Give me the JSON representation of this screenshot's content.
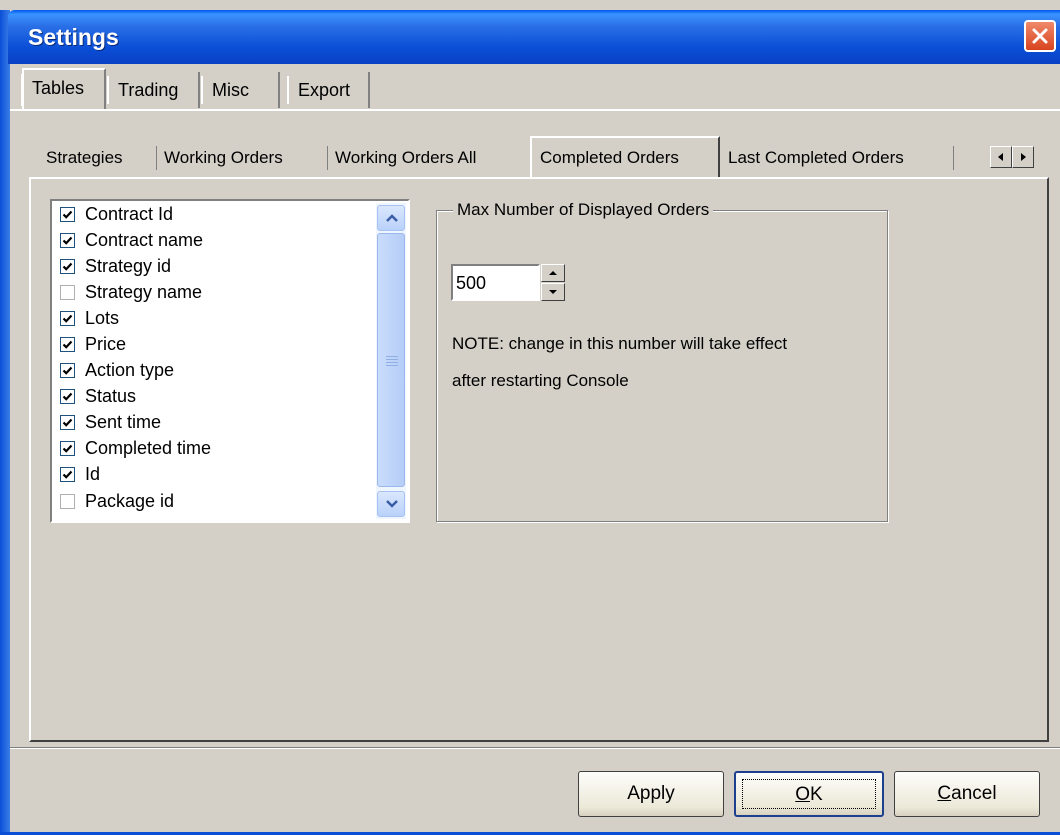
{
  "window": {
    "title": "Settings"
  },
  "main_tabs": [
    {
      "label": "Tables",
      "active": true
    },
    {
      "label": "Trading",
      "active": false
    },
    {
      "label": "Misc",
      "active": false
    },
    {
      "label": "Export",
      "active": false
    }
  ],
  "sub_tabs": [
    {
      "label": "Strategies",
      "active": false
    },
    {
      "label": "Working Orders",
      "active": false
    },
    {
      "label": "Working Orders All",
      "active": false
    },
    {
      "label": "Completed Orders",
      "active": true
    },
    {
      "label": "Last Completed Orders",
      "active": false
    }
  ],
  "columns_list": {
    "items": [
      {
        "label": "Contract Id",
        "checked": true
      },
      {
        "label": "Contract name",
        "checked": true
      },
      {
        "label": "Strategy id",
        "checked": true
      },
      {
        "label": "Strategy name",
        "checked": false
      },
      {
        "label": "Lots",
        "checked": true
      },
      {
        "label": "Price",
        "checked": true
      },
      {
        "label": "Action type",
        "checked": true
      },
      {
        "label": "Status",
        "checked": true
      },
      {
        "label": "Sent time",
        "checked": true
      },
      {
        "label": "Completed time",
        "checked": true
      },
      {
        "label": "Id",
        "checked": true
      },
      {
        "label": "Package id",
        "checked": false
      }
    ]
  },
  "max_orders": {
    "group_label": "Max Number of Displayed Orders",
    "value": "500",
    "note_line1": "NOTE: change in this number will take effect",
    "note_line2": "after restarting Console"
  },
  "buttons": {
    "apply": "Apply",
    "ok_underlined": "O",
    "ok_rest": "K",
    "cancel_underlined": "C",
    "cancel_rest": "ancel"
  }
}
